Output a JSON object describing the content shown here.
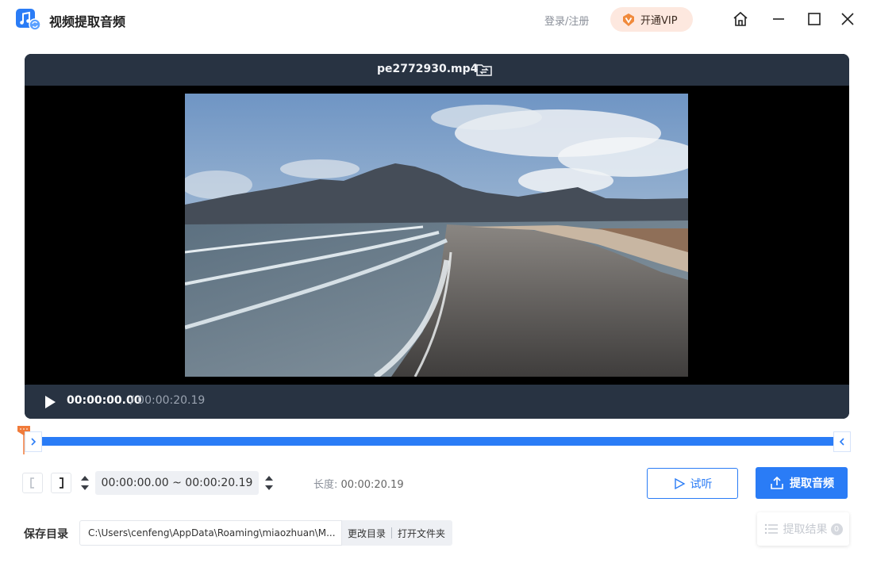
{
  "app": {
    "title": "视频提取音频",
    "login_label": "登录/注册",
    "vip_label": "开通VIP",
    "accent_color": "#2a7cf6"
  },
  "window": {
    "home_icon": "home-icon",
    "minimize_icon": "minimize-icon",
    "maximize_icon": "maximize-icon",
    "close_icon": "close-icon"
  },
  "preview": {
    "file_name": "pe2772930.mp4",
    "current_time": "00:00:00.00",
    "total_time": "/ 00:00:20.19",
    "thumbnail_alt": "aerial beach and mountains video frame"
  },
  "timeline": {
    "selection_start_fraction": 0,
    "selection_end_fraction": 1
  },
  "range": {
    "value": "00:00:00.00 ~ 00:00:20.19",
    "length_label": "长度:",
    "length_value": "00:00:20.19"
  },
  "actions": {
    "listen_label": "试听",
    "extract_label": "提取音频"
  },
  "save": {
    "label": "保存目录",
    "path": "C:\\Users\\cenfeng\\AppData\\Roaming\\miaozhuan\\M...",
    "change_label": "更改目录",
    "open_label": "打开文件夹"
  },
  "results": {
    "label": "提取结果",
    "count": "0"
  }
}
